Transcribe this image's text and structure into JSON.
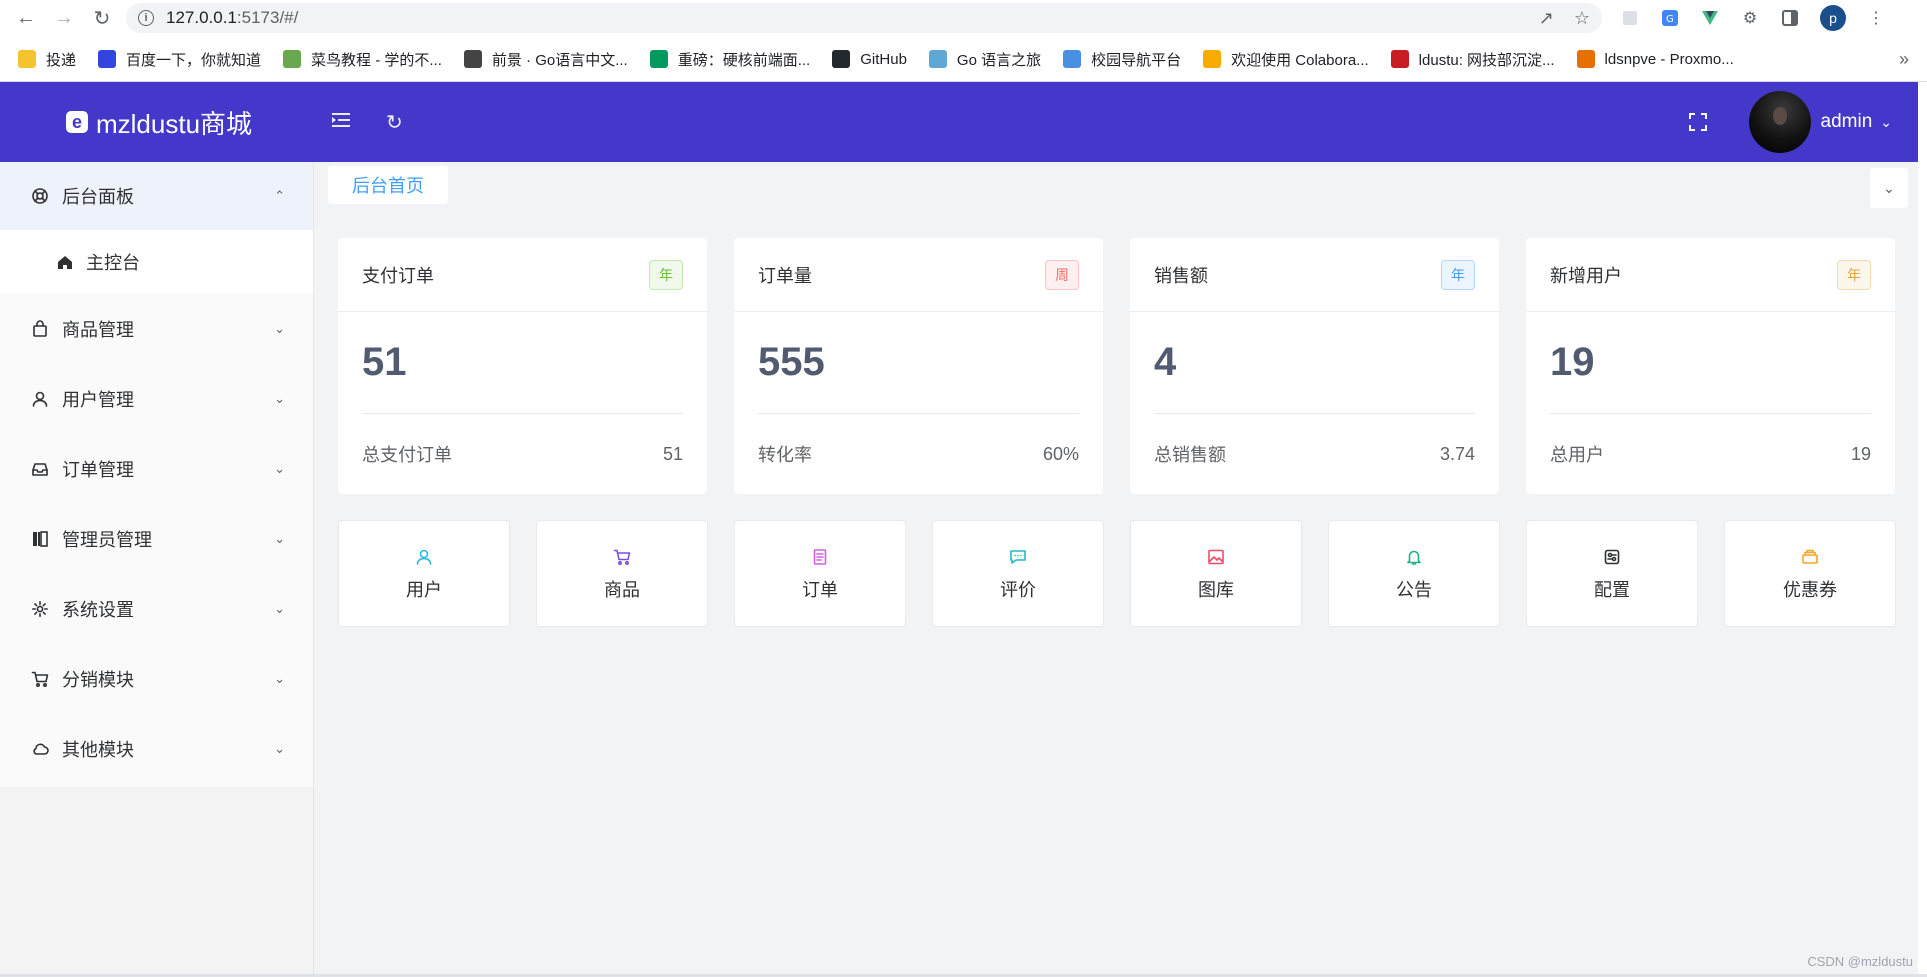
{
  "browser": {
    "url_host": "127.0.0.1",
    "url_rest": ":5173/#/",
    "profile_initial": "p",
    "bookmarks": [
      {
        "label": "投递",
        "icon": "folder-icon",
        "color": "#f4c430"
      },
      {
        "label": "百度一下，你就知道",
        "icon": "baidu-icon",
        "color": "#3245df"
      },
      {
        "label": "菜鸟教程 - 学的不...",
        "icon": "runoob-icon",
        "color": "#6aa84f"
      },
      {
        "label": "前景 · Go语言中文...",
        "icon": "book-icon",
        "color": "#444444"
      },
      {
        "label": "重磅：硬核前端面...",
        "icon": "sf-icon",
        "color": "#009a61"
      },
      {
        "label": "GitHub",
        "icon": "github-icon",
        "color": "#24292f"
      },
      {
        "label": "Go 语言之旅",
        "icon": "gopher-icon",
        "color": "#5fa8d3"
      },
      {
        "label": "校园导航平台",
        "icon": "nav-icon",
        "color": "#4a90e2"
      },
      {
        "label": "欢迎使用 Colabora...",
        "icon": "colab-icon",
        "color": "#f9ab00"
      },
      {
        "label": "ldustu: 网技部沉淀...",
        "icon": "gitee-icon",
        "color": "#c71d23"
      },
      {
        "label": "ldsnpve - Proxmo...",
        "icon": "proxmox-icon",
        "color": "#e57000"
      }
    ]
  },
  "app": {
    "brand": "mzldustu商城",
    "username": "admin",
    "accent": "#4338ca"
  },
  "sidebar": {
    "items": [
      {
        "label": "后台面板",
        "icon": "dashboard-icon",
        "expanded": true,
        "children": [
          {
            "label": "主控台",
            "icon": "home-icon"
          }
        ]
      },
      {
        "label": "商品管理",
        "icon": "bag-icon"
      },
      {
        "label": "用户管理",
        "icon": "user-icon"
      },
      {
        "label": "订单管理",
        "icon": "inbox-icon"
      },
      {
        "label": "管理员管理",
        "icon": "notebook-icon"
      },
      {
        "label": "系统设置",
        "icon": "gear-icon"
      },
      {
        "label": "分销模块",
        "icon": "cart-icon"
      },
      {
        "label": "其他模块",
        "icon": "cloud-icon"
      }
    ]
  },
  "tabs": {
    "active": "后台首页"
  },
  "stats": [
    {
      "title": "支付订单",
      "tag": "年",
      "tag_color": "green",
      "value": "51",
      "foot_label": "总支付订单",
      "foot_value": "51"
    },
    {
      "title": "订单量",
      "tag": "周",
      "tag_color": "red",
      "value": "555",
      "foot_label": "转化率",
      "foot_value": "60%"
    },
    {
      "title": "销售额",
      "tag": "年",
      "tag_color": "blue",
      "value": "4",
      "foot_label": "总销售额",
      "foot_value": "3.74"
    },
    {
      "title": "新增用户",
      "tag": "年",
      "tag_color": "orange",
      "value": "19",
      "foot_label": "总用户",
      "foot_value": "19"
    }
  ],
  "shortcuts": [
    {
      "label": "用户",
      "icon": "user-icon",
      "color": "#2ab7e8"
    },
    {
      "label": "商品",
      "icon": "cart-icon",
      "color": "#7b4fe0"
    },
    {
      "label": "订单",
      "icon": "document-icon",
      "color": "#d35fe0"
    },
    {
      "label": "评价",
      "icon": "comment-icon",
      "color": "#22b9c4"
    },
    {
      "label": "图库",
      "icon": "picture-icon",
      "color": "#f04b6b"
    },
    {
      "label": "公告",
      "icon": "bell-icon",
      "color": "#20b37a"
    },
    {
      "label": "配置",
      "icon": "settings-card-icon",
      "color": "#303133"
    },
    {
      "label": "优惠券",
      "icon": "coupon-icon",
      "color": "#f5a623"
    }
  ],
  "watermark": "CSDN @mzldustu"
}
